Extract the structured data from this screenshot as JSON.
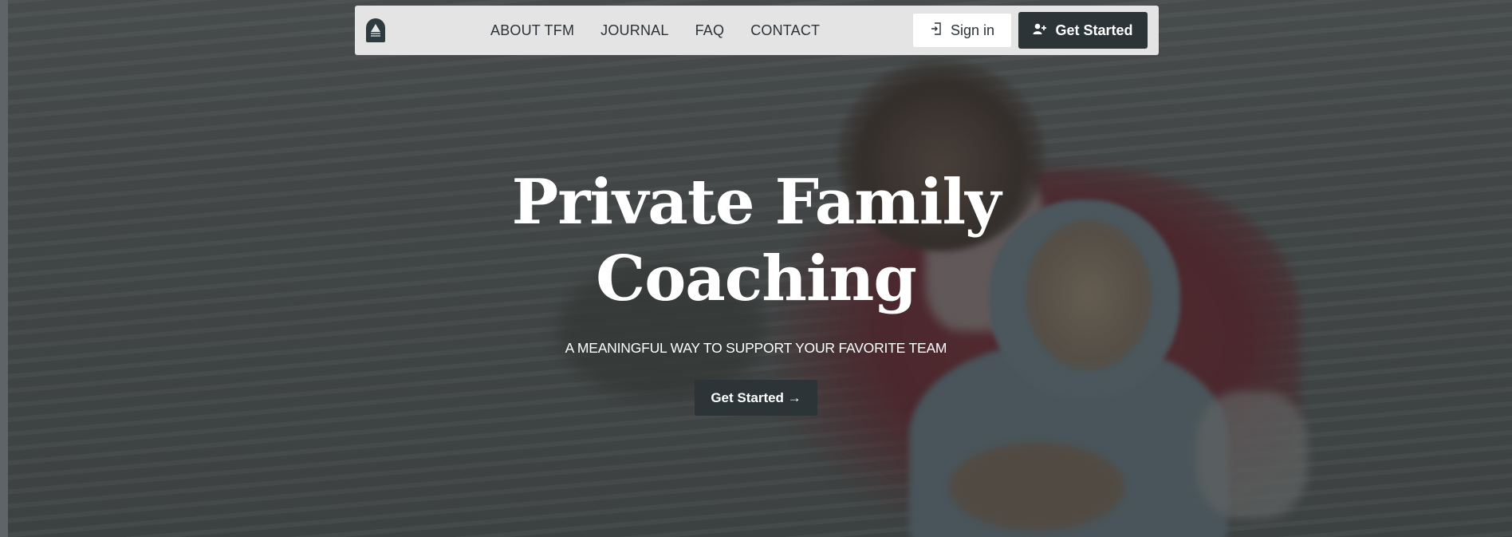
{
  "nav": {
    "links": [
      "ABOUT TFM",
      "JOURNAL",
      "FAQ",
      "CONTACT"
    ],
    "signin_label": "Sign in",
    "get_started_label": "Get Started"
  },
  "hero": {
    "title_line1": "Private Family",
    "title_line2": "Coaching",
    "subtitle": "A MEANINGFUL WAY TO SUPPORT YOUR FAVORITE TEAM",
    "cta_label": "Get Started →"
  },
  "icons": {
    "logo": "lighthouse-logo-icon",
    "signin": "sign-in-icon",
    "get_started": "user-plus-icon"
  },
  "colors": {
    "primary_button": "#2c3438",
    "navbar_bg": "#e8e9e8",
    "text_on_dark": "#ffffff"
  }
}
